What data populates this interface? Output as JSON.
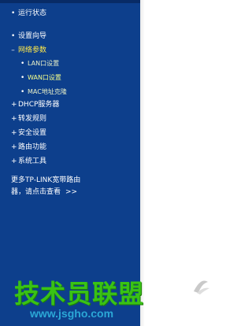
{
  "sidebar": {
    "items": [
      {
        "label": "运行状态",
        "bullet": "•"
      },
      {
        "label": "设置向导",
        "bullet": "•"
      },
      {
        "label": "网络参数",
        "bullet": "–"
      },
      {
        "label": "LAN口设置",
        "bullet": "•"
      },
      {
        "label": "WAN口设置",
        "bullet": "•"
      },
      {
        "label": "MAC地址克隆",
        "bullet": "•"
      },
      {
        "label": "DHCP服务器",
        "bullet": "+"
      },
      {
        "label": "转发规则",
        "bullet": "+"
      },
      {
        "label": "安全设置",
        "bullet": "+"
      },
      {
        "label": "路由功能",
        "bullet": "+"
      },
      {
        "label": "系统工具",
        "bullet": "+"
      }
    ],
    "promo_line1": "更多TP-LINK宽带路由",
    "promo_line2": "器，请点击查看",
    "promo_arrow": ">>"
  },
  "watermark": {
    "title": "技术员联盟",
    "url": "www.jsgho.com"
  },
  "colors": {
    "sidebar_bg": "#0d3f8c",
    "active_text": "#ffe94a",
    "watermark_green": "#39c215",
    "watermark_blue": "#2ba7d6"
  }
}
